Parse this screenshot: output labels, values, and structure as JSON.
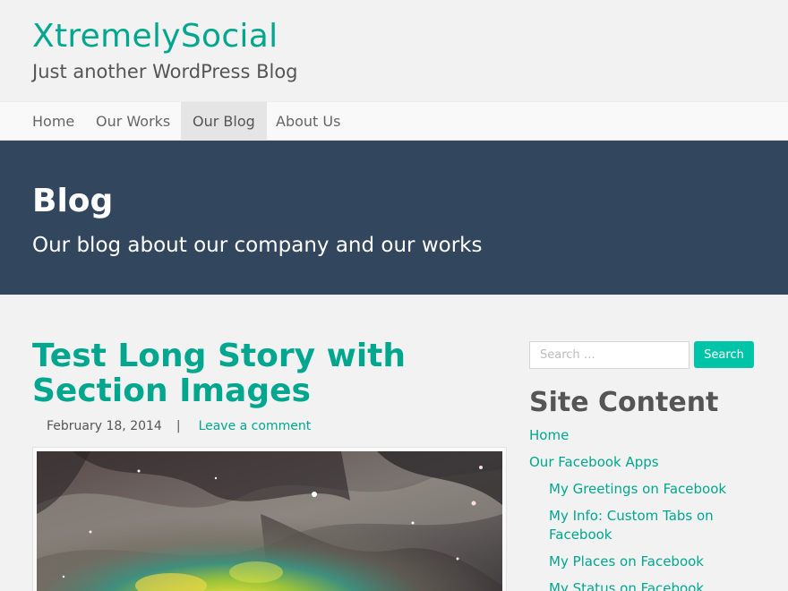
{
  "site": {
    "title": "XtremelySocial",
    "tagline": "Just another WordPress Blog"
  },
  "nav": {
    "items": [
      {
        "label": "Home"
      },
      {
        "label": "Our Works"
      },
      {
        "label": "Our Blog",
        "active": true
      },
      {
        "label": "About Us"
      }
    ]
  },
  "hero": {
    "title": "Blog",
    "subtitle": "Our blog about our company and our works"
  },
  "post": {
    "title": "Test Long Story with Section Images",
    "date": "February 18, 2014",
    "separator": "|",
    "comment_link": "Leave a comment",
    "image_subject": "nebula-photo"
  },
  "sidebar": {
    "search": {
      "placeholder": "Search …",
      "button_label": "Search"
    },
    "widget_title": "Site Content",
    "items": [
      {
        "label": "Home",
        "level": 0
      },
      {
        "label": "Our Facebook Apps",
        "level": 0
      },
      {
        "label": "My Greetings on Facebook",
        "level": 1
      },
      {
        "label": "My Info: Custom Tabs on Facebook",
        "level": 1
      },
      {
        "label": "My Places on Facebook",
        "level": 1
      },
      {
        "label": "My Status on Facebook",
        "level": 1
      }
    ]
  },
  "colors": {
    "accent": "#00a78e",
    "hero_bg": "#32475e",
    "search_button": "#00c4a7",
    "page_bg": "#f2f2f2"
  }
}
